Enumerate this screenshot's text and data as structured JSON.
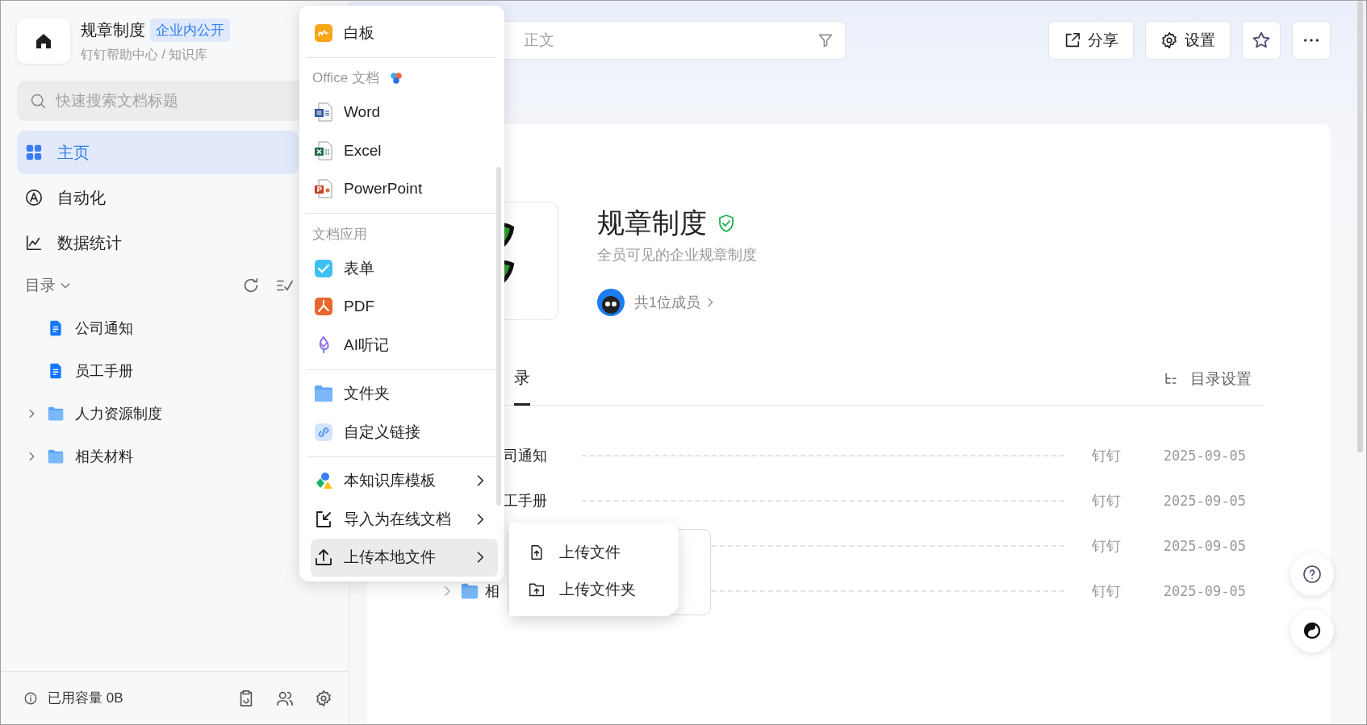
{
  "sidebar": {
    "space": {
      "title": "规章制度",
      "badge": "企业内公开",
      "breadcrumb": "钉钉帮助中心 / 知识库"
    },
    "search": {
      "placeholder": "快速搜索文档标题"
    },
    "nav": [
      {
        "label": "主页",
        "selected": true
      },
      {
        "label": "自动化",
        "selected": false
      },
      {
        "label": "数据统计",
        "selected": false
      }
    ],
    "directory": {
      "label": "目录",
      "expanded": true,
      "items": [
        {
          "kind": "doc",
          "label": "公司通知",
          "selected": false
        },
        {
          "kind": "doc",
          "label": "员工手册",
          "selected": false
        },
        {
          "kind": "folder",
          "label": "人力资源制度",
          "expanded": false,
          "selected": false
        },
        {
          "kind": "folder",
          "label": "相关材料",
          "expanded": false,
          "selected": false
        }
      ]
    },
    "footer": {
      "usage": "已用容量 0B"
    }
  },
  "toolbar": {
    "search": {
      "placeholder": "正文"
    },
    "buttons": [
      {
        "kind": "share",
        "label": "分享"
      },
      {
        "kind": "settings",
        "label": "设置"
      },
      {
        "kind": "star"
      },
      {
        "kind": "more"
      }
    ]
  },
  "space_card": {
    "title": "规章制度",
    "verified": true,
    "description": "全员可见的企业规章制度",
    "members": "共1位成员"
  },
  "tabs": [
    {
      "label": "录",
      "selected": true
    }
  ],
  "directory_settings": "目录设置",
  "rows": [
    {
      "kind": "doc",
      "name": "司通知",
      "author": "钉钉",
      "date": "2025-09-05"
    },
    {
      "kind": "doc",
      "name": "工手册",
      "author": "钉钉",
      "date": "2025-09-05"
    },
    {
      "kind": "hidden",
      "author": "钉钉",
      "date": "2025-09-05"
    },
    {
      "kind": "folder",
      "name": "相",
      "author": "钉钉",
      "date": "2025-09-05"
    }
  ],
  "menu": {
    "groups": [
      {
        "items": [
          {
            "label": "白板",
            "selected": false
          }
        ]
      },
      {
        "header": "Office 文档",
        "header_icon": true,
        "items": [
          {
            "label": "Word",
            "selected": false
          },
          {
            "label": "Excel",
            "selected": false
          },
          {
            "label": "PowerPoint",
            "selected": false
          }
        ]
      },
      {
        "header": "文档应用",
        "items": [
          {
            "label": "表单",
            "selected": false
          },
          {
            "label": "PDF",
            "selected": false
          },
          {
            "label": "AI听记",
            "selected": false
          }
        ]
      },
      {
        "items": [
          {
            "label": "文件夹",
            "selected": false
          },
          {
            "label": "自定义链接",
            "selected": false
          }
        ]
      },
      {
        "items": [
          {
            "label": "本知识库模板",
            "submenu": true,
            "selected": false
          },
          {
            "label": "导入为在线文档",
            "submenu": true,
            "selected": false
          },
          {
            "label": "上传本地文件",
            "submenu": true,
            "selected": true
          }
        ]
      }
    ]
  },
  "submenu": {
    "items": [
      {
        "label": "上传文件",
        "selected": false
      },
      {
        "label": "上传文件夹",
        "selected": false
      }
    ]
  }
}
